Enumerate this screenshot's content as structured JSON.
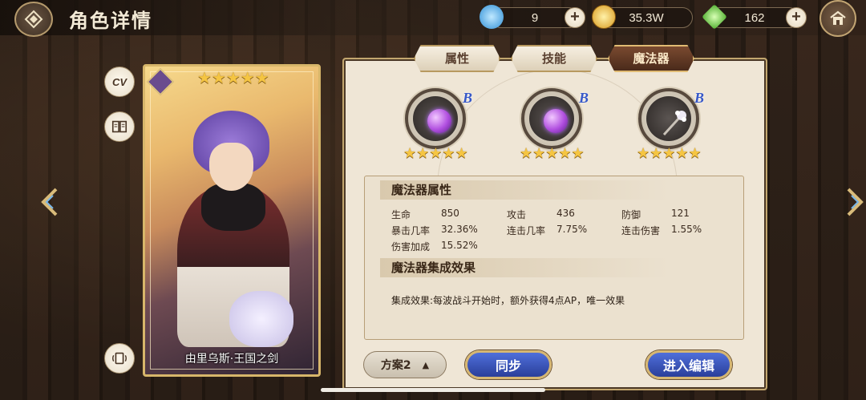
{
  "header": {
    "title": "角色详情",
    "resources": [
      {
        "name": "crystal-icon",
        "value": "9"
      },
      {
        "name": "gold-coin-icon",
        "value": "35.3W"
      },
      {
        "name": "green-gem-icon",
        "value": "162"
      }
    ]
  },
  "card": {
    "name": "由里乌斯·王国之剑",
    "stars": "★★★★★"
  },
  "tabs": [
    {
      "label": "属性",
      "active": false
    },
    {
      "label": "技能",
      "active": false
    },
    {
      "label": "魔法器",
      "active": true
    }
  ],
  "artifacts": [
    {
      "grade": "B",
      "stars": "★★★★★",
      "icon": "purple-gem-ring-icon"
    },
    {
      "grade": "B",
      "stars": "★★★★★",
      "icon": "purple-gem-ring-icon"
    },
    {
      "grade": "B",
      "stars": "★★★★★",
      "icon": "crystal-staff-icon"
    }
  ],
  "attributes": {
    "section_title": "魔法器属性",
    "stats": [
      {
        "label": "生命",
        "value": "850"
      },
      {
        "label": "攻击",
        "value": "436"
      },
      {
        "label": "防御",
        "value": "121"
      },
      {
        "label": "暴击几率",
        "value": "32.36%"
      },
      {
        "label": "连击几率",
        "value": "7.75%"
      },
      {
        "label": "连击伤害",
        "value": "1.55%"
      },
      {
        "label": "伤害加成",
        "value": "15.52%"
      }
    ]
  },
  "set_effect": {
    "section_title": "魔法器集成效果",
    "text": "集成效果:每波战斗开始时，额外获得4点AP，唯一效果"
  },
  "footer": {
    "plan_label": "方案2",
    "plan_caret": "▲",
    "sync_label": "同步",
    "edit_label": "进入编辑"
  },
  "colors": {
    "accent_gold": "#d7b66a",
    "button_blue": "#3a55bd",
    "grade_blue": "#3758c8"
  }
}
